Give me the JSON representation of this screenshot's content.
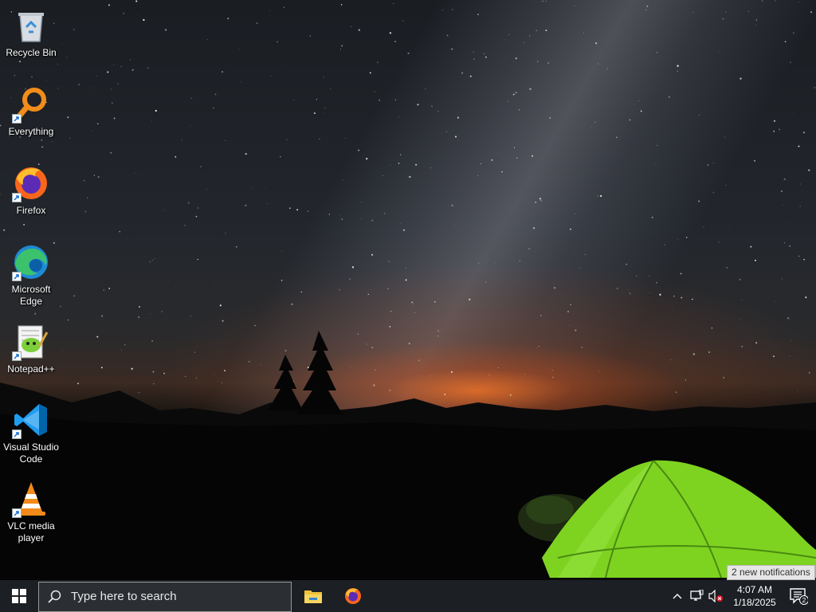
{
  "desktop": {
    "icons": [
      {
        "name": "recycle-bin",
        "label": "Recycle Bin",
        "shortcut": false
      },
      {
        "name": "everything",
        "label": "Everything",
        "shortcut": true
      },
      {
        "name": "firefox",
        "label": "Firefox",
        "shortcut": true
      },
      {
        "name": "microsoft-edge",
        "label": "Microsoft Edge",
        "shortcut": true
      },
      {
        "name": "notepad-plus-plus",
        "label": "Notepad++",
        "shortcut": true
      },
      {
        "name": "visual-studio-code",
        "label": "Visual Studio Code",
        "shortcut": true
      },
      {
        "name": "vlc-media-player",
        "label": "VLC media player",
        "shortcut": true
      }
    ]
  },
  "taskbar": {
    "search": {
      "placeholder": "Type here to search"
    },
    "pinned": [
      {
        "name": "file-explorer-icon"
      },
      {
        "name": "firefox-icon"
      }
    ],
    "tray": {
      "overflow_icon": "chevron-up-icon",
      "network_icon": "network-icon",
      "volume_icon": "volume-muted-icon",
      "time": "4:07 AM",
      "date": "1/18/2025",
      "notification_count": "2",
      "notification_tooltip": "2 new notifications"
    }
  },
  "colors": {
    "taskbar": "#1c1f24",
    "tent": "#7ed321",
    "horizon_glow": "#e86a20"
  }
}
